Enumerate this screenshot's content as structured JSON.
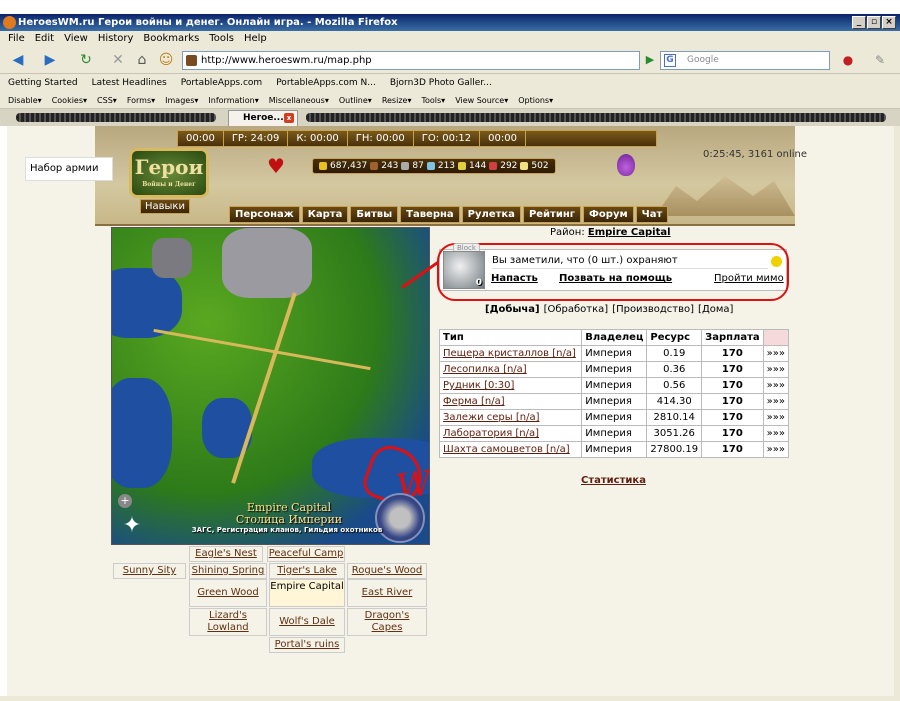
{
  "window": {
    "title": "HeroesWM.ru Герои войны и денег. Онлайн игра. - Mozilla Firefox",
    "buttons": [
      "_",
      "▫",
      "×"
    ]
  },
  "menubar": [
    "File",
    "Edit",
    "View",
    "History",
    "Bookmarks",
    "Tools",
    "Help"
  ],
  "navbar": {
    "url": "http://www.heroeswm.ru/map.php",
    "search_placeholder": "Google"
  },
  "bookmarks": [
    "Getting Started",
    "Latest Headlines",
    "PortableApps.com",
    "PortableApps.com N...",
    "Bjorn3D Photo Galler..."
  ],
  "devbar": [
    "Disable▾",
    "Cookies▾",
    "CSS▾",
    "Forms▾",
    "Images▾",
    "Information▾",
    "Miscellaneous▾",
    "Outline▾",
    "Resize▾",
    "Tools▾",
    "View Source▾",
    "Options▾"
  ],
  "tab": {
    "label": "Heroe..."
  },
  "game": {
    "army_set": "Набор армии",
    "logo_text": "Герои",
    "logo_subtitle": "Войны и Денег",
    "timers": [
      "00:00",
      "ГР: 24:09",
      "К: 00:00",
      "ГН: 00:00",
      "ГО: 00:12",
      "00:00"
    ],
    "resources": [
      {
        "value": "687,437",
        "color": "#e8c020"
      },
      {
        "value": "243",
        "color": "#a06030"
      },
      {
        "value": "87",
        "color": "#aaaaaa"
      },
      {
        "value": "213",
        "color": "#80c0e0"
      },
      {
        "value": "144",
        "color": "#e0d040"
      },
      {
        "value": "292",
        "color": "#d04040"
      },
      {
        "value": "502",
        "color": "#f0e080"
      }
    ],
    "online": "0:25:45, 3161 online",
    "skills": "Навыки",
    "menu": [
      "Персонаж",
      "Карта",
      "Битвы",
      "Таверна",
      "Рулетка",
      "Рейтинг",
      "Форум",
      "Чат"
    ]
  },
  "map": {
    "city_en": "Empire Capital",
    "city_ru": "Столица Империи",
    "guilds": "ЗАГС, Регистрация кланов, Гильдия охотников",
    "annotation": "WTF?!"
  },
  "district": {
    "label": "Район:",
    "name": "Empire Capital"
  },
  "encounter": {
    "block": "Block",
    "monster_count": "0",
    "guard_text": "Вы заметили, что (0 шт.) охраняют",
    "attack": "Напасть",
    "help": "Позвать на помощь",
    "pass": "Пройти мимо"
  },
  "subtabs": [
    "[Добыча]",
    "[Обработка]",
    "[Производство]",
    "[Дома]"
  ],
  "table": {
    "headers": [
      "Тип",
      "Владелец",
      "Ресурс",
      "Зарплата",
      ""
    ],
    "rows": [
      [
        "Пещера кристаллов [n/a]",
        "Империя",
        "0.19",
        "170",
        "»»»"
      ],
      [
        "Лесопилка [n/a]",
        "Империя",
        "0.36",
        "170",
        "»»»"
      ],
      [
        "Рудник [0:30]",
        "Империя",
        "0.56",
        "170",
        "»»»"
      ],
      [
        "Ферма [n/a]",
        "Империя",
        "414.30",
        "170",
        "»»»"
      ],
      [
        "Залежи серы [n/a]",
        "Империя",
        "2810.14",
        "170",
        "»»»"
      ],
      [
        "Лаборатория [n/a]",
        "Империя",
        "3051.26",
        "170",
        "»»»"
      ],
      [
        "Шахта самоцветов [n/a]",
        "Империя",
        "27800.19",
        "170",
        "»»»"
      ]
    ]
  },
  "stats_link": "Статистика",
  "regions": {
    "eagles_nest": "Eagle's Nest",
    "peaceful_camp": "Peaceful Camp",
    "sunny_sity": "Sunny Sity",
    "shining_spring": "Shining Spring",
    "tigers_lake": "Tiger's Lake",
    "rogues_wood": "Rogue's Wood",
    "green_wood": "Green Wood",
    "empire_capital": "Empire Capital",
    "east_river": "East River",
    "lizards_lowland": "Lizard's Lowland",
    "wolfs_dale": "Wolf's Dale",
    "dragons_capes": "Dragon's Capes",
    "portals_ruins": "Portal's ruins"
  }
}
